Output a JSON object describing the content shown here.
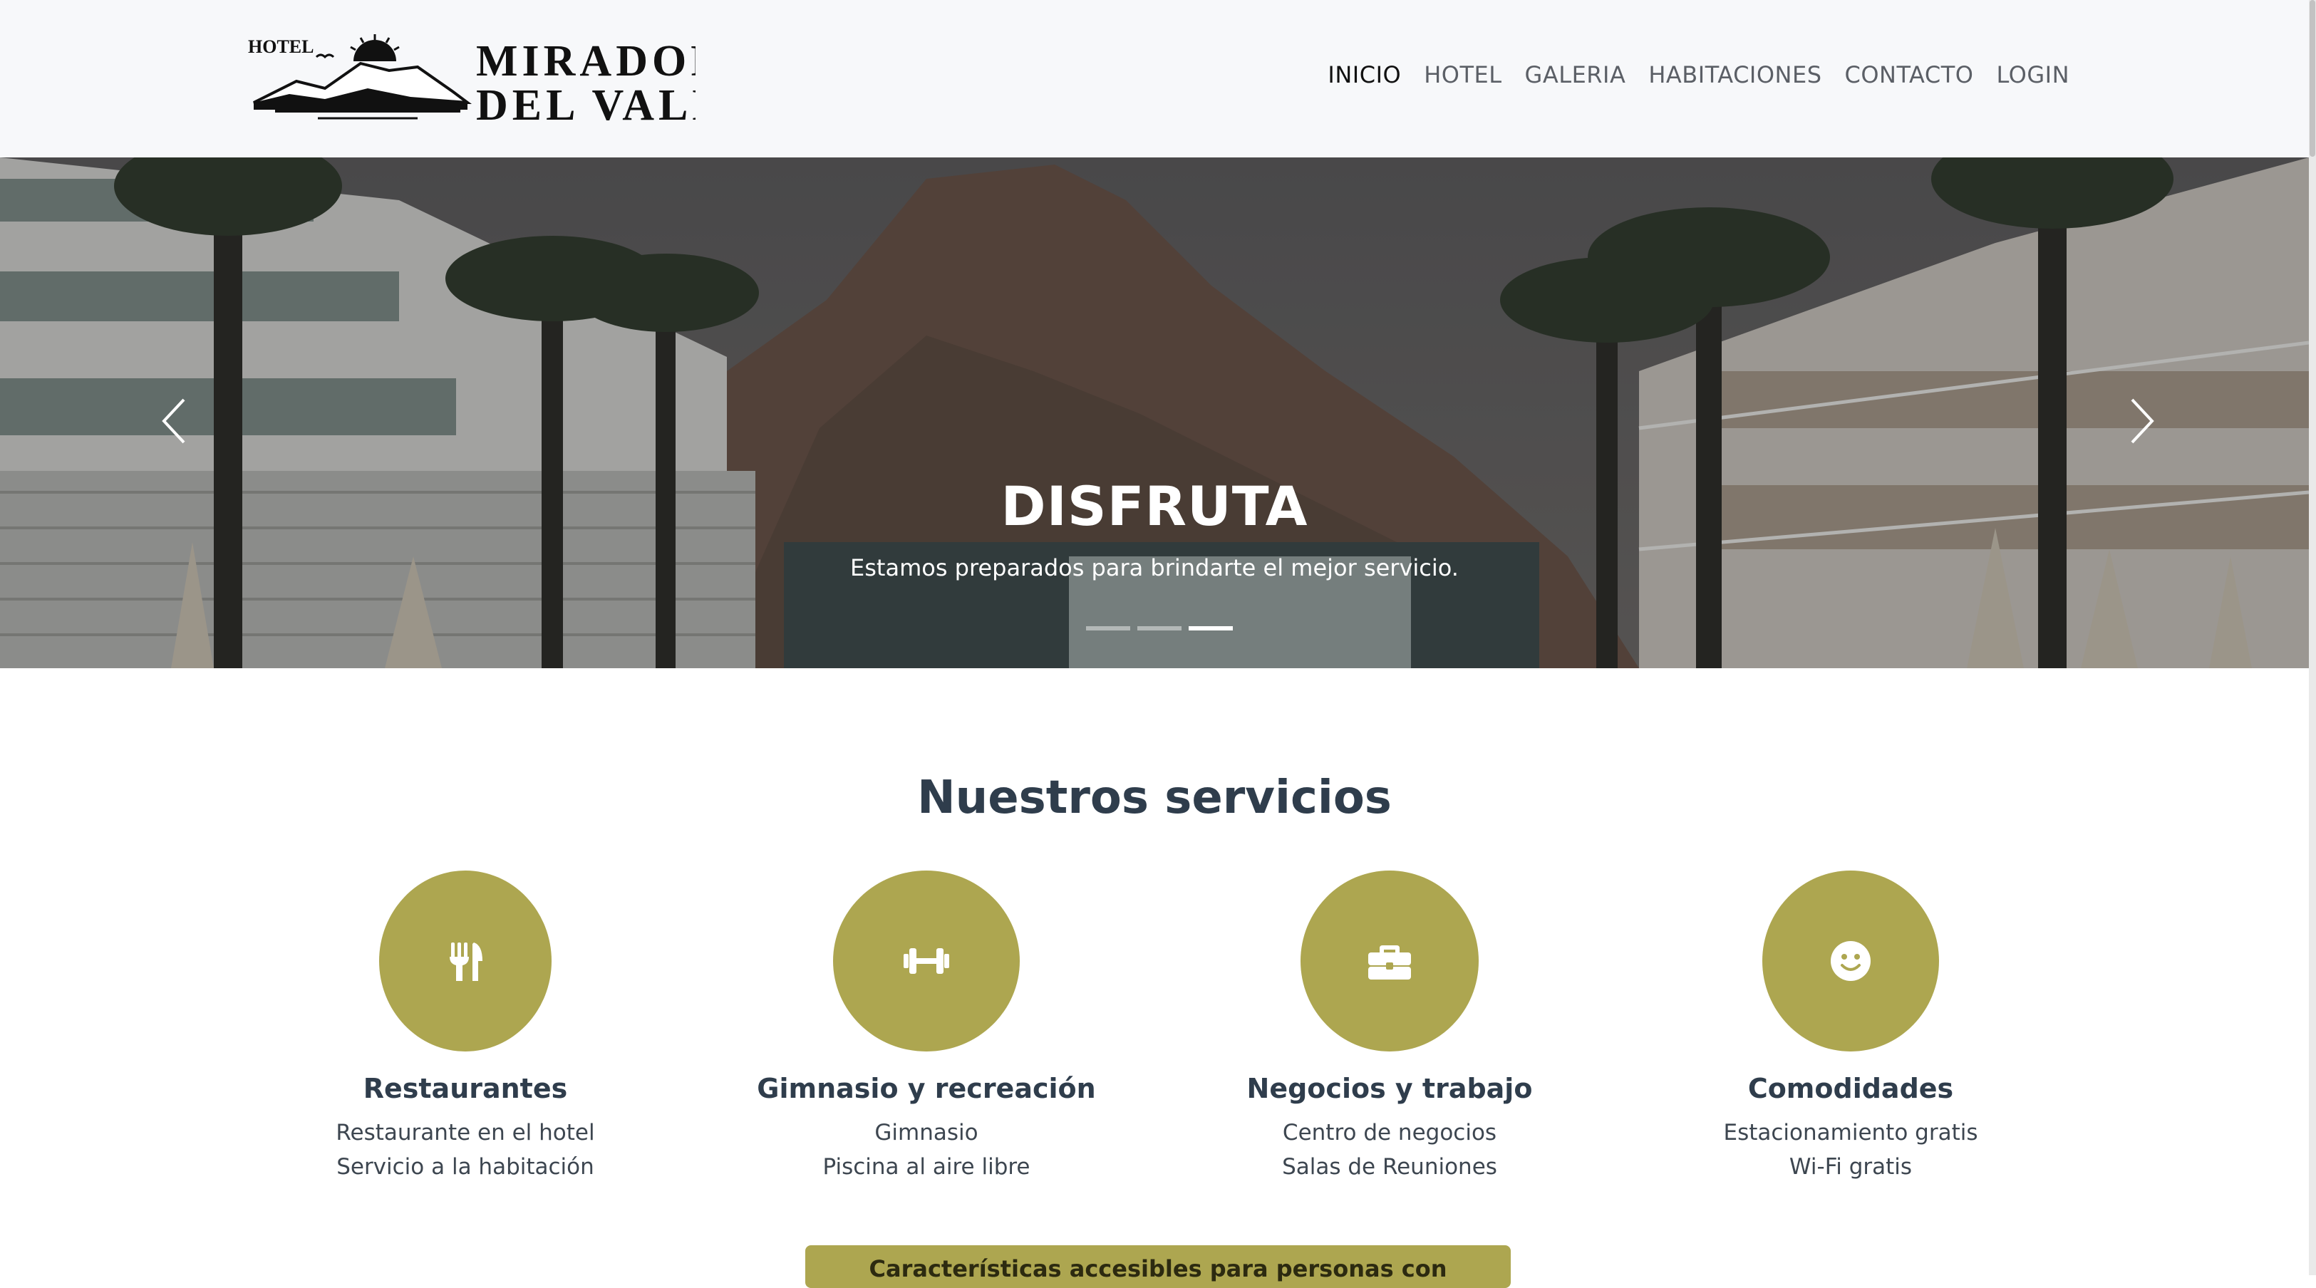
{
  "logo": {
    "small": "HOTEL",
    "line1": "MIRADOR",
    "line2": "DEL VALLE"
  },
  "nav": {
    "inicio": "INICIO",
    "hotel": "HOTEL",
    "galeria": "GALERIA",
    "habitaciones": "HABITACIONES",
    "contacto": "CONTACTO",
    "login": "LOGIN",
    "active": "INICIO"
  },
  "hero": {
    "title": "DISFRUTA",
    "subtitle": "Estamos preparados para brindarte el mejor servicio.",
    "active_slide": 3,
    "slide_count": 3
  },
  "services": {
    "title": "Nuestros servicios",
    "items": [
      {
        "icon": "utensils-icon",
        "title": "Restaurantes",
        "line1": "Restaurante en el hotel",
        "line2": "Servicio a la habitación"
      },
      {
        "icon": "dumbbell-icon",
        "title": "Gimnasio y recreación",
        "line1": "Gimnasio",
        "line2": "Piscina al aire libre"
      },
      {
        "icon": "briefcase-icon",
        "title": "Negocios y trabajo",
        "line1": "Centro de negocios",
        "line2": "Salas de Reuniones"
      },
      {
        "icon": "smile-icon",
        "title": "Comodidades",
        "line1": "Estacionamiento gratis",
        "line2": "Wi-Fi gratis"
      }
    ]
  },
  "accessibility_label": "Características accesibles para personas con discapacidades",
  "colors": {
    "accent": "#ada650",
    "heading": "#2f3d4c",
    "topbar": "#f7f8fa"
  }
}
